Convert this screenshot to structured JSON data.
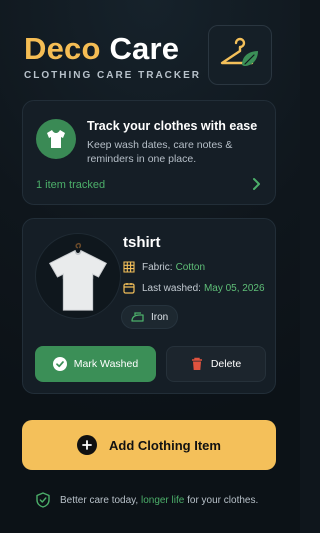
{
  "brand": {
    "title_part1": "Deco",
    "title_part2": "Care",
    "subtitle": "CLOTHING CARE TRACKER"
  },
  "info_card": {
    "title": "Track your clothes with ease",
    "description": "Keep wash dates, care notes & reminders in one place.",
    "tracked_text": "1 item tracked"
  },
  "item": {
    "name": "tshirt",
    "fabric_label": "Fabric:",
    "fabric_value": "Cotton",
    "washed_label": "Last washed:",
    "washed_value": "May 05, 2026",
    "care_tag": "Iron",
    "mark_washed_label": "Mark Washed",
    "delete_label": "Delete"
  },
  "add_button": {
    "label": "Add Clothing Item"
  },
  "footer": {
    "text_before": "Better care today, ",
    "highlight": "longer life",
    "text_after": " for your clothes."
  },
  "colors": {
    "accent_yellow": "#f4c05a",
    "accent_green": "#3b8f57",
    "link_green": "#4caf6a",
    "background": "#0f161c",
    "card": "#151e26",
    "delete_red": "#e0533f"
  },
  "icons": {
    "logo": "hanger-leaf-icon",
    "info": "tshirt-icon",
    "fabric": "grid-icon",
    "washed": "calendar-icon",
    "care": "iron-icon",
    "mark_washed": "check-circle-icon",
    "delete": "trash-icon",
    "add": "plus-circle-icon",
    "footer": "shield-check-icon",
    "chevron": "chevron-right-icon"
  }
}
